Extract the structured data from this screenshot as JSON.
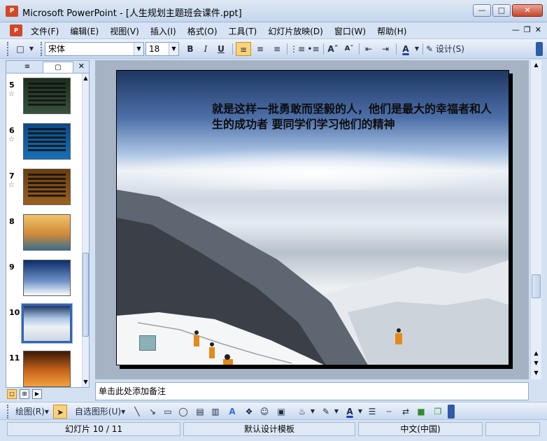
{
  "window": {
    "title": "Microsoft PowerPoint - [人生规划主题班会课件.ppt]",
    "app_icon": "P",
    "buttons": [
      "minimize",
      "maximize",
      "close"
    ]
  },
  "menu": {
    "items": [
      "文件(F)",
      "编辑(E)",
      "视图(V)",
      "插入(I)",
      "格式(O)",
      "工具(T)",
      "幻灯片放映(D)",
      "窗口(W)",
      "帮助(H)"
    ]
  },
  "format_toolbar": {
    "font_name": "宋体",
    "font_size": "18",
    "bold": "B",
    "italic": "I",
    "underline": "U",
    "design_label": "设计(S)"
  },
  "slides": [
    {
      "number": "5",
      "has_star": true,
      "theme": "dark-green"
    },
    {
      "number": "6",
      "has_star": true,
      "theme": "blue"
    },
    {
      "number": "7",
      "has_star": true,
      "theme": "brown"
    },
    {
      "number": "8",
      "has_star": false,
      "theme": "tree"
    },
    {
      "number": "9",
      "has_star": false,
      "theme": "mountain"
    },
    {
      "number": "10",
      "has_star": false,
      "theme": "snow",
      "selected": true
    },
    {
      "number": "11",
      "has_star": false,
      "theme": "sunset"
    }
  ],
  "current_slide": {
    "text": "就是这样一批勇敢而坚毅的人，他们是最大的幸福者和人生的成功者 要同学们学习他们的精神"
  },
  "notes": {
    "placeholder": "单击此处添加备注"
  },
  "draw_toolbar": {
    "draw_label": "绘图(R)",
    "autoshapes_label": "自选图形(U)"
  },
  "status": {
    "slide_info": "幻灯片 10 / 11",
    "template": "默认设计模板",
    "language": "中文(中国)"
  },
  "colors": {
    "accent": "#3565b0",
    "highlight": "#ffd27a",
    "font_color_bar": "#1f3fbf"
  }
}
